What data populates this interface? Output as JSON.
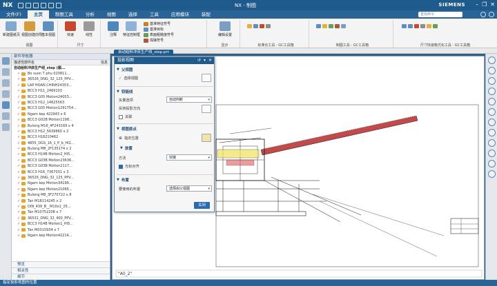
{
  "app": {
    "logo": "NX",
    "window_title": "NX - 制图",
    "brand": "SIEMENS"
  },
  "menu": {
    "tabs": [
      "文件(F)",
      "主页",
      "制图工具",
      "分析",
      "视图",
      "选择",
      "工具",
      "应用模块",
      "装配"
    ],
    "active_index": 1,
    "search_placeholder": "查找命令"
  },
  "ribbon": {
    "groups": [
      {
        "label": "",
        "buttons": [
          "新建图纸页",
          "视图创建向导",
          "基本视图"
        ]
      },
      {
        "label": "视图",
        "buttons": [
          "快速",
          "线性",
          "半径"
        ]
      },
      {
        "label": "尺寸",
        "buttons": []
      },
      {
        "label": "注释",
        "buttons": [
          "注释",
          "特征控制框"
        ]
      },
      {
        "label": "",
        "buttons": [
          "编辑设置"
        ]
      },
      {
        "label": "显示",
        "buttons": []
      },
      {
        "label": "标准化工具 - GC工具箱",
        "buttons": []
      },
      {
        "label": "制图工具 - GC工具箱",
        "buttons": []
      },
      {
        "label": "尺寸快速格式化工具 - GC工具箱",
        "buttons": []
      }
    ],
    "small_items": [
      "基准特征符号",
      "基准目标",
      "表面粗糙度符号",
      "焊接符号"
    ]
  },
  "document_tab": "自动给料冲床生产线_step.prt",
  "navigator": {
    "title": "部件导航器",
    "col_name": "描述性部件名",
    "col_info": "信息",
    "root": "自动给料冲床生产线_step (顺...",
    "items": [
      "Bo suon T phu 020811...",
      "36526_DNG_32_125_PPV...",
      "LAP HOAN CHINH24353...",
      "BCC3 H11_2469103",
      "BCC3 G05 Motion24053...",
      "BCC3 H12_14625563",
      "BCC3 G05 Motion1291754...",
      "Ngam kep 422943 x 6",
      "BCC3 G02B Motion1198...",
      "Bulong M16_4F243169 x 4",
      "BCC3 H12_5639860 x 2",
      "BCC3 H18210462",
      "4855_DGS_16_1_P_b_HI2...",
      "Bulong M8_2F135174 x 2",
      "BCC3 H14B Motion2_HI5...",
      "BCC3 G03B Motion23636...",
      "BCC3 G03B Motion2117...",
      "BCC3 H16_7367031 x 3",
      "36526_DNG_32_125_PPV...",
      "Ngam kep Motion34199...",
      "Ngam kep Motion21065...",
      "Bulong M8_3F270722 x 8",
      "Tan M18114245 x 2",
      "DIN_439_B__M10x1_25...",
      "Tan M10752208 x 7",
      "36531_DNG_32_400_PPV...",
      "BCC3 H14B Motion1_HI5...",
      "Tan M0315934 x 7",
      "Ngam kep Motion42214..."
    ],
    "footer": [
      "预览",
      "相关性",
      "细节"
    ]
  },
  "dialog": {
    "title": "投影视图",
    "sec_parent": "父视图",
    "select_view": "选择视图",
    "sec_hinge": "铰链线",
    "vector_label": "矢量选项",
    "vector_value": "自动判断",
    "reverse_label": "反转投影方向",
    "associative": "关联",
    "sec_origin": "视图原点",
    "specify_pos": "指定位置",
    "sec_place": "放置",
    "method_label": "方法",
    "method_value": "铰链",
    "align_cursor": "光标对齐",
    "sec_layout": "布置",
    "target_label": "要使用的布置",
    "target_value": "选择由父视图",
    "close": "关闭"
  },
  "canvas": {
    "sheet_label": "\"A0_2\""
  },
  "statusbar": "指定投影视图的位置",
  "colors": {
    "titlebar": "#1f5a8c",
    "accent": "#2a6bb0",
    "check_red": "#c1272d"
  }
}
